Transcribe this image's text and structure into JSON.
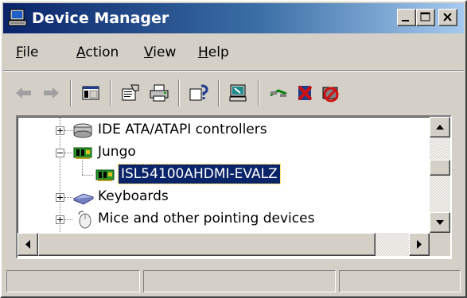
{
  "window": {
    "title": "Device Manager",
    "icon": "device-manager-icon",
    "controls": [
      "minimize-icon",
      "maximize-icon",
      "close-icon"
    ]
  },
  "menu": {
    "file": {
      "u": "F",
      "rest": "ile"
    },
    "action": {
      "u": "A",
      "rest": "ction"
    },
    "view": {
      "u": "V",
      "rest": "iew"
    },
    "help": {
      "u": "H",
      "rest": "elp"
    }
  },
  "toolbar": {
    "icons": [
      "back-arrow-icon",
      "forward-arrow-icon",
      "show-hide-console-tree-icon",
      "properties-icon",
      "print-icon",
      "help-icon",
      "scan-hardware-icon",
      "update-driver-icon",
      "uninstall-icon",
      "disable-device-icon"
    ]
  },
  "tree": {
    "items": [
      {
        "label": "IDE ATA/ATAPI controllers",
        "state": "collapsed",
        "icon": "ide-controller-icon"
      },
      {
        "label": "Jungo",
        "state": "expanded",
        "icon": "board-icon"
      },
      {
        "label": "ISL54100AHDMI-EVALZ",
        "state": "leaf",
        "selected": true,
        "icon": "board-icon"
      },
      {
        "label": "Keyboards",
        "state": "collapsed",
        "icon": "keyboard-icon"
      },
      {
        "label": "Mice and other pointing devices",
        "state": "collapsed",
        "icon": "mouse-icon"
      }
    ]
  },
  "colors": {
    "titlebar_start": "#0a246a",
    "titlebar_end": "#a6caf0",
    "face": "#d4d0c8",
    "selection": "#0a246a"
  }
}
